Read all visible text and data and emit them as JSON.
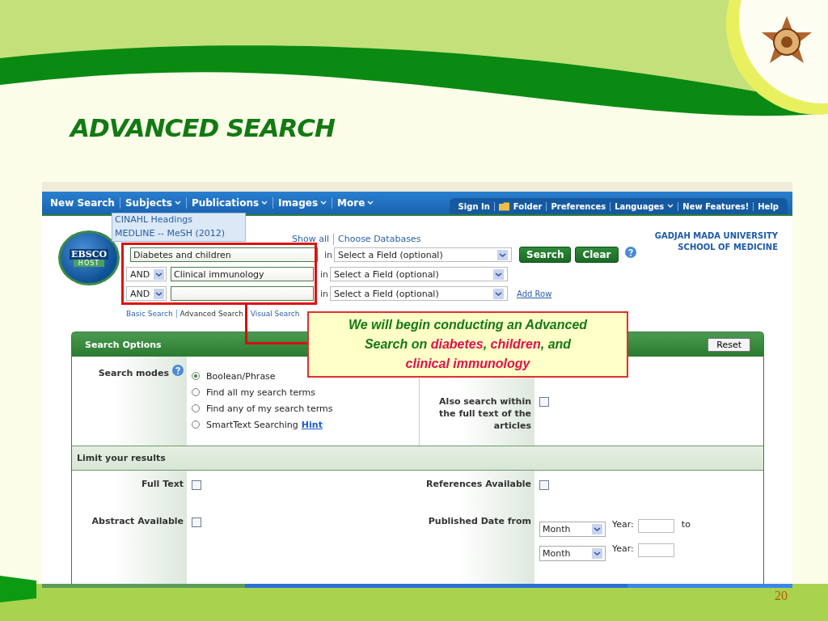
{
  "slide": {
    "title": "ADVANCED SEARCH",
    "page_number": "20"
  },
  "nav": {
    "items": [
      {
        "label": "New Search",
        "dropdown": false
      },
      {
        "label": "Subjects",
        "dropdown": true
      },
      {
        "label": "Publications",
        "dropdown": true
      },
      {
        "label": "Images",
        "dropdown": true
      },
      {
        "label": "More",
        "dropdown": true
      }
    ],
    "utility": [
      {
        "label": "Sign In",
        "kind": "link"
      },
      {
        "label": "Folder",
        "kind": "folder"
      },
      {
        "label": "Preferences",
        "kind": "link"
      },
      {
        "label": "Languages",
        "kind": "dropdown"
      },
      {
        "label": "New Features!",
        "kind": "link"
      },
      {
        "label": "Help",
        "kind": "link"
      }
    ],
    "dropdown": [
      "CINAHL Headings",
      "MEDLINE -- MeSH (2012)"
    ]
  },
  "logo": {
    "line1": "EBSCO",
    "line2": "HOST"
  },
  "search": {
    "links": [
      "Show all",
      "Choose Databases"
    ],
    "rows": [
      {
        "term": "Diabetes and children",
        "in": "in",
        "field": "Select a Field (optional)"
      },
      {
        "operator": "AND",
        "term": "Clinical immunology",
        "in": "in",
        "field": "Select a Field (optional)"
      },
      {
        "operator": "AND",
        "term": "",
        "in": "in",
        "field": "Select a Field (optional)"
      }
    ],
    "buttons": [
      "Search",
      "Clear"
    ],
    "add_row": "Add Row",
    "modes": [
      {
        "label": "Basic Search",
        "selected": false
      },
      {
        "label": "Advanced Search",
        "selected": true
      },
      {
        "label": "Visual Search",
        "selected": false
      }
    ]
  },
  "institution": [
    "GADJAH MADA UNIVERSITY",
    "SCHOOL OF MEDICINE"
  ],
  "options": {
    "title": "Search Options",
    "reset": "Reset",
    "modes_label": "Search modes",
    "modes": [
      {
        "label": "Boolean/Phrase",
        "selected": true
      },
      {
        "label": "Find all my search terms",
        "selected": false
      },
      {
        "label": "Find any of my search terms",
        "selected": false
      },
      {
        "label": "SmartText Searching",
        "selected": false,
        "hint": "Hint"
      }
    ],
    "fulltext": {
      "label": "Also search within the full text of the articles",
      "checked": false
    }
  },
  "limits": {
    "title": "Limit your results",
    "left": [
      {
        "label": "Full Text",
        "checked": false
      },
      {
        "label": "Abstract Available",
        "checked": false
      }
    ],
    "right": [
      {
        "kind": "checkbox",
        "label": "References Available",
        "checked": false
      },
      {
        "kind": "date",
        "label": "Published Date from",
        "rows": [
          {
            "month": "Month",
            "year_label": "Year:",
            "suffix": "to"
          },
          {
            "month": "Month",
            "year_label": "Year:"
          }
        ]
      }
    ]
  },
  "callout": [
    {
      "text": "We will begin conducting an Advanced Search on ",
      "highlight": false
    },
    {
      "text": "diabetes",
      "highlight": true
    },
    {
      "text": ", ",
      "highlight": false
    },
    {
      "text": "children",
      "highlight": true
    },
    {
      "text": ", and ",
      "highlight": false
    },
    {
      "text": "clinical immunology",
      "highlight": true
    }
  ]
}
